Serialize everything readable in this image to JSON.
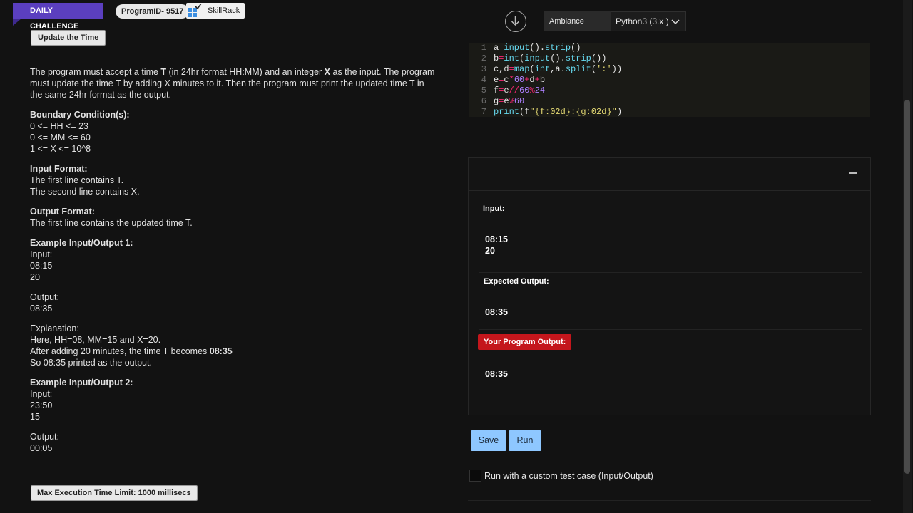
{
  "header": {
    "daily_label": "DAILY CHALLENGE",
    "program_id": "ProgramID- 9517",
    "brand": "SkillRack",
    "update_btn": "Update the Time"
  },
  "problem": {
    "intro_1": "The program must accept a time ",
    "intro_T": "T",
    "intro_2": " (in 24hr format HH:MM) and an integer ",
    "intro_X": "X",
    "intro_3": " as the input. The program must update the time T by adding X minutes to it. Then the program must print the updated time T in the same 24hr format as the output.",
    "boundary_heading": "Boundary Condition(s):",
    "boundary": [
      "0 <= HH <= 23",
      "0 <= MM <= 60",
      "1 <= X <= 10^8"
    ],
    "input_heading": "Input Format:",
    "input_lines": [
      "The first line contains T.",
      "The second line contains X."
    ],
    "output_heading": "Output Format:",
    "output_lines": [
      "The first line contains the updated time T."
    ],
    "ex1_heading": "Example Input/Output 1:",
    "ex1_input_label": "Input:",
    "ex1_input": [
      "08:15",
      "20"
    ],
    "ex1_output_label": "Output:",
    "ex1_output": "08:35",
    "expl_label": "Explanation:",
    "expl_1": "Here, HH=08, MM=15 and X=20.",
    "expl_2a": "After adding 20 minutes, the time T becomes ",
    "expl_2b": "08:35",
    "expl_3": "So 08:35 printed as the output.",
    "ex2_heading": "Example Input/Output 2:",
    "ex2_input_label": "Input:",
    "ex2_input": [
      "23:50",
      "15"
    ],
    "ex2_output_label": "Output:",
    "ex2_output": "00:05"
  },
  "footer": {
    "max_time": "Max Execution Time Limit: 1000 millisecs"
  },
  "toolbar": {
    "ambiance": "Ambiance",
    "language": "Python3 (3.x )"
  },
  "editor": {
    "line_numbers": [
      "1",
      "2",
      "3",
      "4",
      "5",
      "6",
      "7"
    ]
  },
  "result": {
    "input_label": "Input:",
    "input_vals": [
      "08:15",
      "20"
    ],
    "expected_label": "Expected Output:",
    "expected_val": "08:35",
    "yours_label": "Your Program Output:",
    "yours_val": "08:35"
  },
  "actions": {
    "save": "Save",
    "run": "Run",
    "custom": "Run with a custom test case (Input/Output)"
  },
  "colors": {
    "daily_badge": "#5b3fbf",
    "your_output": "#c4161c",
    "action_button": "#8ec7ff"
  }
}
